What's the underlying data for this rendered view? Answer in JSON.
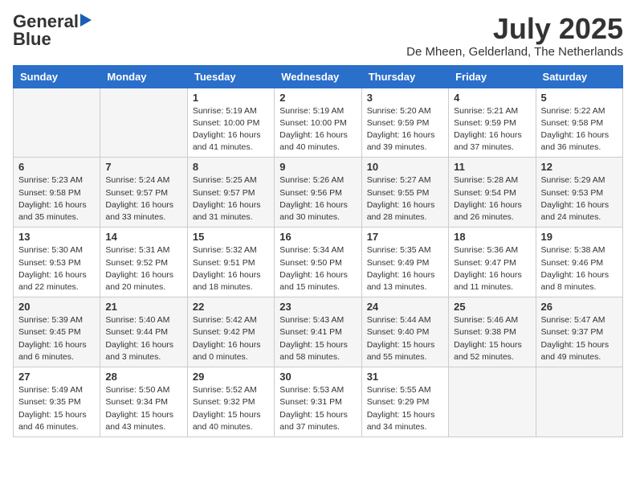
{
  "header": {
    "logo_line1": "General",
    "logo_line2": "Blue",
    "month": "July 2025",
    "location": "De Mheen, Gelderland, The Netherlands"
  },
  "days_of_week": [
    "Sunday",
    "Monday",
    "Tuesday",
    "Wednesday",
    "Thursday",
    "Friday",
    "Saturday"
  ],
  "weeks": [
    [
      {
        "num": "",
        "info": ""
      },
      {
        "num": "",
        "info": ""
      },
      {
        "num": "1",
        "info": "Sunrise: 5:19 AM\nSunset: 10:00 PM\nDaylight: 16 hours\nand 41 minutes."
      },
      {
        "num": "2",
        "info": "Sunrise: 5:19 AM\nSunset: 10:00 PM\nDaylight: 16 hours\nand 40 minutes."
      },
      {
        "num": "3",
        "info": "Sunrise: 5:20 AM\nSunset: 9:59 PM\nDaylight: 16 hours\nand 39 minutes."
      },
      {
        "num": "4",
        "info": "Sunrise: 5:21 AM\nSunset: 9:59 PM\nDaylight: 16 hours\nand 37 minutes."
      },
      {
        "num": "5",
        "info": "Sunrise: 5:22 AM\nSunset: 9:58 PM\nDaylight: 16 hours\nand 36 minutes."
      }
    ],
    [
      {
        "num": "6",
        "info": "Sunrise: 5:23 AM\nSunset: 9:58 PM\nDaylight: 16 hours\nand 35 minutes."
      },
      {
        "num": "7",
        "info": "Sunrise: 5:24 AM\nSunset: 9:57 PM\nDaylight: 16 hours\nand 33 minutes."
      },
      {
        "num": "8",
        "info": "Sunrise: 5:25 AM\nSunset: 9:57 PM\nDaylight: 16 hours\nand 31 minutes."
      },
      {
        "num": "9",
        "info": "Sunrise: 5:26 AM\nSunset: 9:56 PM\nDaylight: 16 hours\nand 30 minutes."
      },
      {
        "num": "10",
        "info": "Sunrise: 5:27 AM\nSunset: 9:55 PM\nDaylight: 16 hours\nand 28 minutes."
      },
      {
        "num": "11",
        "info": "Sunrise: 5:28 AM\nSunset: 9:54 PM\nDaylight: 16 hours\nand 26 minutes."
      },
      {
        "num": "12",
        "info": "Sunrise: 5:29 AM\nSunset: 9:53 PM\nDaylight: 16 hours\nand 24 minutes."
      }
    ],
    [
      {
        "num": "13",
        "info": "Sunrise: 5:30 AM\nSunset: 9:53 PM\nDaylight: 16 hours\nand 22 minutes."
      },
      {
        "num": "14",
        "info": "Sunrise: 5:31 AM\nSunset: 9:52 PM\nDaylight: 16 hours\nand 20 minutes."
      },
      {
        "num": "15",
        "info": "Sunrise: 5:32 AM\nSunset: 9:51 PM\nDaylight: 16 hours\nand 18 minutes."
      },
      {
        "num": "16",
        "info": "Sunrise: 5:34 AM\nSunset: 9:50 PM\nDaylight: 16 hours\nand 15 minutes."
      },
      {
        "num": "17",
        "info": "Sunrise: 5:35 AM\nSunset: 9:49 PM\nDaylight: 16 hours\nand 13 minutes."
      },
      {
        "num": "18",
        "info": "Sunrise: 5:36 AM\nSunset: 9:47 PM\nDaylight: 16 hours\nand 11 minutes."
      },
      {
        "num": "19",
        "info": "Sunrise: 5:38 AM\nSunset: 9:46 PM\nDaylight: 16 hours\nand 8 minutes."
      }
    ],
    [
      {
        "num": "20",
        "info": "Sunrise: 5:39 AM\nSunset: 9:45 PM\nDaylight: 16 hours\nand 6 minutes."
      },
      {
        "num": "21",
        "info": "Sunrise: 5:40 AM\nSunset: 9:44 PM\nDaylight: 16 hours\nand 3 minutes."
      },
      {
        "num": "22",
        "info": "Sunrise: 5:42 AM\nSunset: 9:42 PM\nDaylight: 16 hours\nand 0 minutes."
      },
      {
        "num": "23",
        "info": "Sunrise: 5:43 AM\nSunset: 9:41 PM\nDaylight: 15 hours\nand 58 minutes."
      },
      {
        "num": "24",
        "info": "Sunrise: 5:44 AM\nSunset: 9:40 PM\nDaylight: 15 hours\nand 55 minutes."
      },
      {
        "num": "25",
        "info": "Sunrise: 5:46 AM\nSunset: 9:38 PM\nDaylight: 15 hours\nand 52 minutes."
      },
      {
        "num": "26",
        "info": "Sunrise: 5:47 AM\nSunset: 9:37 PM\nDaylight: 15 hours\nand 49 minutes."
      }
    ],
    [
      {
        "num": "27",
        "info": "Sunrise: 5:49 AM\nSunset: 9:35 PM\nDaylight: 15 hours\nand 46 minutes."
      },
      {
        "num": "28",
        "info": "Sunrise: 5:50 AM\nSunset: 9:34 PM\nDaylight: 15 hours\nand 43 minutes."
      },
      {
        "num": "29",
        "info": "Sunrise: 5:52 AM\nSunset: 9:32 PM\nDaylight: 15 hours\nand 40 minutes."
      },
      {
        "num": "30",
        "info": "Sunrise: 5:53 AM\nSunset: 9:31 PM\nDaylight: 15 hours\nand 37 minutes."
      },
      {
        "num": "31",
        "info": "Sunrise: 5:55 AM\nSunset: 9:29 PM\nDaylight: 15 hours\nand 34 minutes."
      },
      {
        "num": "",
        "info": ""
      },
      {
        "num": "",
        "info": ""
      }
    ]
  ]
}
